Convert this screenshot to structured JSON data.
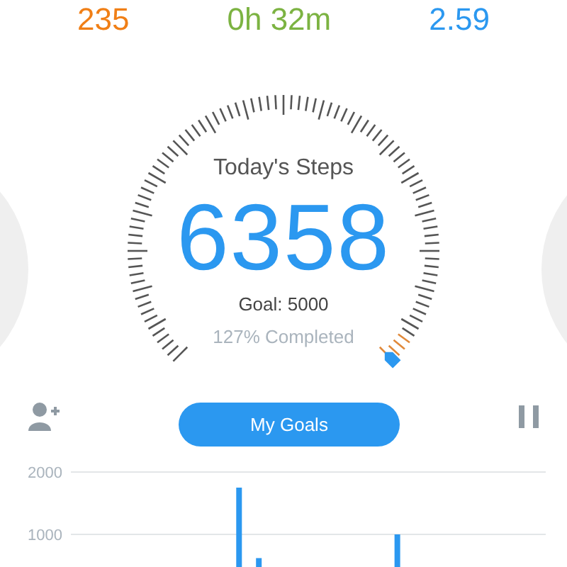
{
  "stats": [
    {
      "value": "235",
      "color": "#f07f16"
    },
    {
      "value": "0h 32m",
      "color": "#7cb342"
    },
    {
      "value": "2.59",
      "color": "#2b98f0"
    }
  ],
  "gauge": {
    "title": "Today's Steps",
    "steps": "6358",
    "goal": "Goal: 5000",
    "progress": "127% Completed"
  },
  "goals_button": {
    "label": "My Goals"
  },
  "chart_data": {
    "type": "bar",
    "values": [
      0,
      0,
      0,
      0,
      0,
      0,
      0,
      0,
      1750,
      620,
      0,
      0,
      0,
      0,
      0,
      0,
      1000,
      0,
      0,
      0,
      0,
      0,
      0,
      0
    ],
    "yticks": [
      1000,
      2000
    ],
    "ylim": [
      0,
      2000
    ]
  }
}
